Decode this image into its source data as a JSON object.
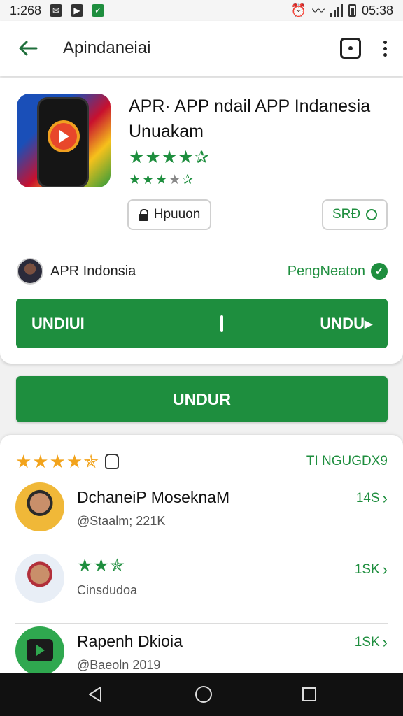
{
  "status_bar": {
    "time": "1:268",
    "clock_right": "05:38",
    "icons": [
      "notification-icon",
      "store-icon",
      "app-icon",
      "alarm-icon",
      "wifi-icon",
      "signal-icon",
      "battery-icon"
    ]
  },
  "app_bar": {
    "title": "Apindaneiai",
    "back_icon": "arrow-left-icon",
    "search_icon": "search-icon",
    "more_icon": "more-vert-icon"
  },
  "app": {
    "name": "APR· APP ndail APP Indanesia Unuakam",
    "rating_stars": "★★★★✰",
    "small_stars_filled": "★★★",
    "small_stars_dim": "★",
    "small_stars_tail": "✰",
    "chip_lock_label": "Hpuuon",
    "chip_size_label": "SRÐ"
  },
  "developer": {
    "name": "APR Indonsia",
    "link_label": "PengNeaton"
  },
  "split_button": {
    "left_label": "UNDIUI",
    "right_label": "UNDU▸"
  },
  "main_button": {
    "label": "UNDUR"
  },
  "ratings": {
    "stars": "★★★★✯",
    "count_label": "TI NGUGDX9"
  },
  "reviews": [
    {
      "title": "DchaneiP MoseknaM",
      "subtitle": "@Staalm; 221K",
      "count": "14S"
    },
    {
      "stars": "★★✯",
      "subtitle": "Cinsdudoa",
      "count": "1SK"
    },
    {
      "title": "Rapenh Dkioia",
      "subtitle": "@Baeoln 2019",
      "count": "1SK"
    }
  ],
  "colors": {
    "accent_green": "#1e8e3e",
    "star_gold": "#f2a31b",
    "nav_bar": "#111111"
  }
}
